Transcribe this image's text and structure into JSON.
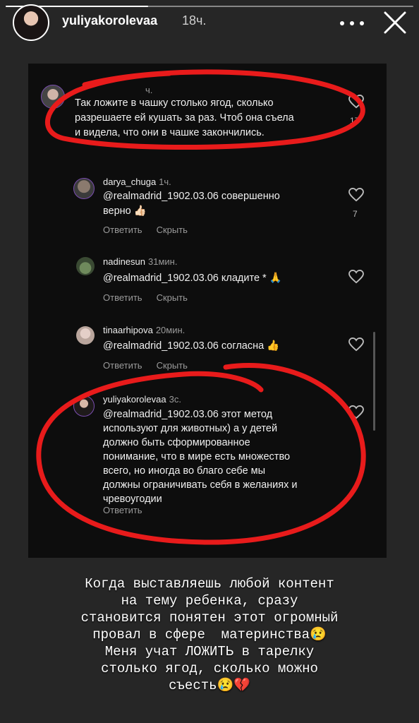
{
  "story": {
    "username": "yuliyakorolevaa",
    "time": "18ч.",
    "progress": 0.35
  },
  "comments": [
    {
      "username": "",
      "time": "ч.",
      "text": [
        "Так ложите в чашку столько ягод, сколько",
        "разрешаете ей кушать за раз. Чтоб она съела",
        "и видела, что они в чашке закончились."
      ],
      "likes": "17"
    },
    {
      "username": "darya_chuga",
      "time": "1ч.",
      "text": [
        "@realmadrid_1902.03.06 совершенно",
        "верно 👍🏻"
      ],
      "likes": "7",
      "reply": "Ответить",
      "hide": "Скрыть"
    },
    {
      "username": "nadinesun",
      "time": "31мин.",
      "text": [
        "@realmadrid_1902.03.06 кладите * 🙏"
      ],
      "reply": "Ответить",
      "hide": "Скрыть"
    },
    {
      "username": "tinaarhipova",
      "time": "20мин.",
      "text": [
        "@realmadrid_1902.03.06 согласна 👍"
      ],
      "reply": "Ответить",
      "hide": "Скрыть"
    },
    {
      "username": "yuliyakorolevaa",
      "time": "3с.",
      "text": [
        "@realmadrid_1902.03.06 этот метод",
        "используют для животных) а у детей",
        "должно быть сформированное",
        "понимание, что в мире есть множество",
        "всего, но иногда во благо себе мы",
        "должны ограничивать себя в желаниях и",
        "чревоугодии"
      ],
      "reply": "Ответить"
    }
  ],
  "caption": [
    "Когда выставляешь любой контент",
    "на тему ребенка, сразу",
    "становится понятен этот огромный",
    "провал в сфере  материнства😢",
    "Меня учат ЛОЖИТЬ в тарелку",
    "столько ягод, сколько можно",
    "съесть😢💔"
  ],
  "colors": {
    "annotation": "#e81b1b",
    "background": "#262626"
  }
}
